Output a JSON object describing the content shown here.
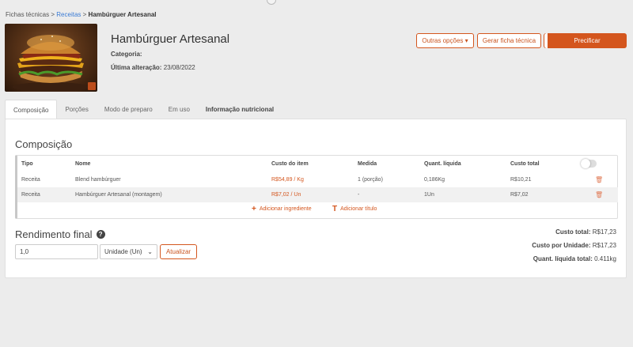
{
  "breadcrumb": {
    "root": "Fichas técnicas",
    "sep": ">",
    "parent": "Receitas",
    "current": "Hambúrguer Artesanal"
  },
  "recipe": {
    "title": "Hambúrguer Artesanal",
    "category_label": "Categoria:",
    "category_value": "",
    "last_change_label": "Última alteração:",
    "last_change_value": "23/08/2022"
  },
  "actions": {
    "more_options": "Outras opções",
    "more_caret": "▾",
    "generate_sheet": "Gerar ficha técnica",
    "price": "Precificar"
  },
  "tabs": [
    {
      "label": "Composição",
      "active": true
    },
    {
      "label": "Porções"
    },
    {
      "label": "Modo de preparo"
    },
    {
      "label": "Em uso"
    },
    {
      "label": "Informação nutricional"
    }
  ],
  "composition": {
    "title": "Composição",
    "columns": {
      "tipo": "Tipo",
      "nome": "Nome",
      "custo": "Custo do item",
      "medida": "Medida",
      "quant": "Quant. líquida",
      "total": "Custo total"
    },
    "rows": [
      {
        "tipo": "Receita",
        "nome": "Blend hambúrguer",
        "custo": "R$54,89 / Kg",
        "medida": "1 (porção)",
        "quant": "0,186Kg",
        "total": "R$10,21"
      },
      {
        "tipo": "Receita",
        "nome": "Hambúrguer Artesanal (montagem)",
        "custo": "R$7,02 / Un",
        "medida": "-",
        "quant": "1Un",
        "total": "R$7,02"
      }
    ],
    "add_ingredient": "Adicionar ingrediente",
    "add_title": "Adicionar título",
    "add_ingredient_icon": "+",
    "add_title_icon": "T"
  },
  "yield": {
    "title": "Rendimento final",
    "help_icon": "?",
    "value": "1,0",
    "unit": "Unidade (Un)",
    "unit_caret": "⌄",
    "update": "Atualizar"
  },
  "totals": {
    "total_label": "Custo total:",
    "total_value": "R$17,23",
    "per_unit_label": "Custo por Unidade:",
    "per_unit_value": "R$17,23",
    "quant_label": "Quant. líquida total:",
    "quant_value": "0.411kg"
  },
  "colors": {
    "accent": "#d4561e",
    "background": "#ececec"
  }
}
